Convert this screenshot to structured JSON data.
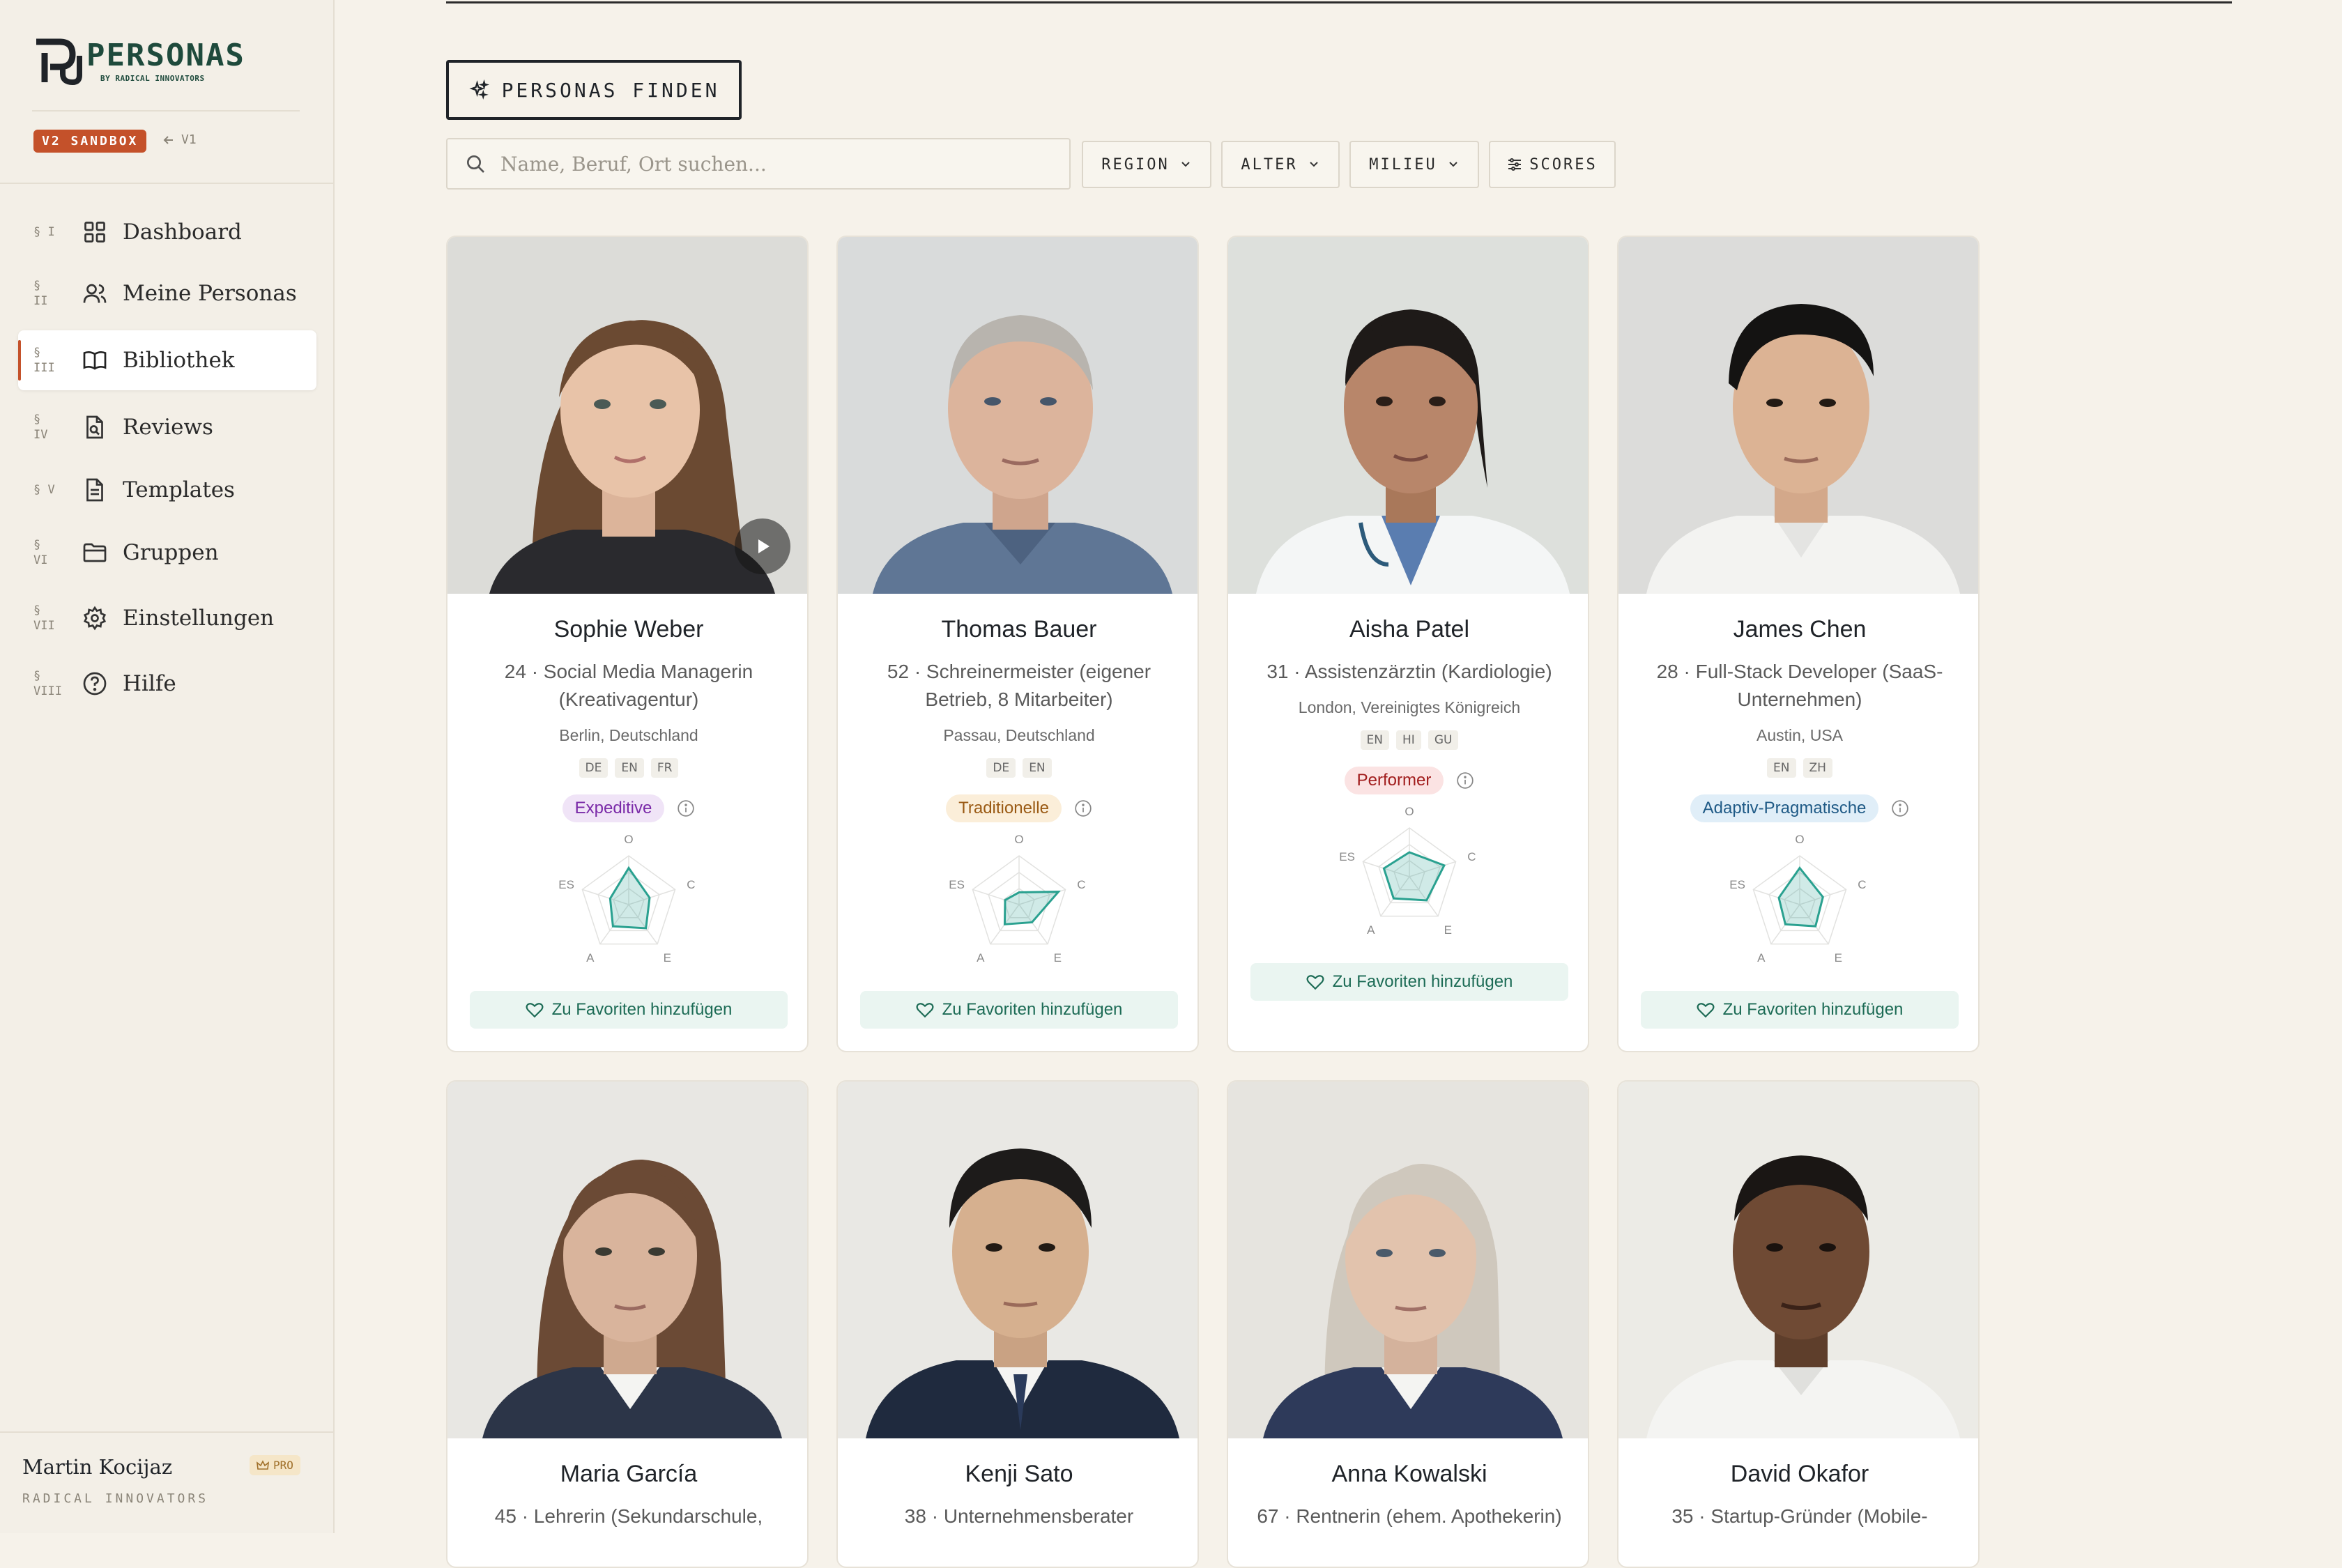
{
  "sidebar": {
    "brand_name": "PERSONAS",
    "brand_sub": "BY RADICAL INNOVATORS",
    "sandbox_badge": "V2 SANDBOX",
    "v1_link": "V1",
    "items": [
      {
        "num": "§ I",
        "label": "Dashboard",
        "icon": "grid-icon"
      },
      {
        "num": "§\nII",
        "label": "Meine Personas",
        "icon": "users-icon"
      },
      {
        "num": "§\nIII",
        "label": "Bibliothek",
        "icon": "book-icon",
        "active": true
      },
      {
        "num": "§\nIV",
        "label": "Reviews",
        "icon": "review-doc-icon"
      },
      {
        "num": "§ V",
        "label": "Templates",
        "icon": "document-icon"
      },
      {
        "num": "§\nVI",
        "label": "Gruppen",
        "icon": "folder-icon"
      },
      {
        "num": "§\nVII",
        "label": "Einstellungen",
        "icon": "gear-icon"
      },
      {
        "num": "§\nVIII",
        "label": "Hilfe",
        "icon": "help-icon"
      }
    ],
    "user": {
      "name": "Martin Kocijaz",
      "org": "RADICAL INNOVATORS",
      "plan": "PRO"
    }
  },
  "toolbar": {
    "find_label": "PERSONAS FINDEN",
    "search_placeholder": "Name, Beruf, Ort suchen...",
    "filters": [
      "REGION",
      "ALTER",
      "MILIEU",
      "SCORES"
    ]
  },
  "colors": {
    "accent": "#c4512a",
    "teal": "#2aa190",
    "fav_bg": "#eaf5f1"
  },
  "personas": [
    {
      "name": "Sophie Weber",
      "role": "24 · Social Media Managerin (Kreativagentur)",
      "location": "Berlin, Deutschland",
      "languages": [
        "DE",
        "EN",
        "FR"
      ],
      "milieu": "Expeditive",
      "milieu_bg": "#f0e4f7",
      "milieu_fg": "#7a2aa8",
      "scores": {
        "O": 0.75,
        "C": 0.45,
        "E": 0.6,
        "A": 0.55,
        "ES": 0.4
      },
      "fav": "Zu Favoriten hinzufügen",
      "video": true
    },
    {
      "name": "Thomas Bauer",
      "role": "52 · Schreinermeister (eigener Betrieb, 8 Mitarbeiter)",
      "location": "Passau, Deutschland",
      "languages": [
        "DE",
        "EN"
      ],
      "milieu": "Traditionelle",
      "milieu_bg": "#fbeed9",
      "milieu_fg": "#9a5a14",
      "scores": {
        "O": 0.25,
        "C": 0.85,
        "E": 0.45,
        "A": 0.5,
        "ES": 0.3
      },
      "fav": "Zu Favoriten hinzufügen",
      "video": false
    },
    {
      "name": "Aisha Patel",
      "role": "31 · Assistenzärztin (Kardiologie)",
      "location": "London, Vereinigtes Königreich",
      "languages": [
        "EN",
        "HI",
        "GU"
      ],
      "milieu": "Performer",
      "milieu_bg": "#fbe3e3",
      "milieu_fg": "#a11d1d",
      "scores": {
        "O": 0.5,
        "C": 0.75,
        "E": 0.6,
        "A": 0.55,
        "ES": 0.55
      },
      "fav": "Zu Favoriten hinzufügen",
      "video": false
    },
    {
      "name": "James Chen",
      "role": "28 · Full-Stack Developer (SaaS-Unternehmen)",
      "location": "Austin, USA",
      "languages": [
        "EN",
        "ZH"
      ],
      "milieu": "Adaptiv-Pragmatische",
      "milieu_bg": "#e0eef8",
      "milieu_fg": "#1f5a86",
      "scores": {
        "O": 0.75,
        "C": 0.5,
        "E": 0.55,
        "A": 0.5,
        "ES": 0.45
      },
      "fav": "Zu Favoriten hinzufügen",
      "video": false
    },
    {
      "name": "Maria García",
      "role": "45 · Lehrerin (Sekundarschule,",
      "skin": "#d9b49c",
      "hair": "#6b4a35",
      "bg": "#e8e7e3",
      "shirt": "#2c3548"
    },
    {
      "name": "Kenji Sato",
      "role": "38 · Unternehmensberater",
      "skin": "#d6b08f",
      "hair": "#1d1b1a",
      "bg": "#e9e8e4",
      "shirt": "#1f2a3e"
    },
    {
      "name": "Anna Kowalski",
      "role": "67 · Rentnerin (ehem. Apothekerin)",
      "skin": "#e2c3ad",
      "hair": "#cfc8bd",
      "bg": "#e6e4df",
      "shirt": "#2e3a5a"
    },
    {
      "name": "David Okafor",
      "role": "35 · Startup-Gründer (Mobile-",
      "skin": "#6f4a34",
      "hair": "#1a1614",
      "bg": "#ecebe6",
      "shirt": "#f4f4f2"
    }
  ],
  "radar_axes": [
    "O",
    "C",
    "E",
    "A",
    "ES"
  ]
}
